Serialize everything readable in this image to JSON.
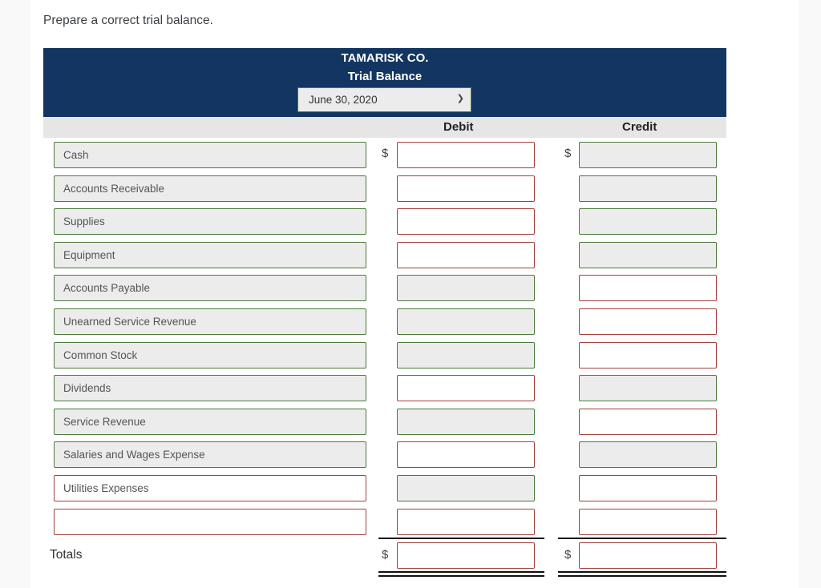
{
  "prompt": "Prepare a correct trial balance.",
  "header": {
    "company": "TAMARISK CO.",
    "title": "Trial Balance",
    "date_select": {
      "selected": "June 30, 2020"
    }
  },
  "columns": {
    "debit": "Debit",
    "credit": "Credit"
  },
  "currency_symbol": "$",
  "rows": [
    {
      "account": "Cash",
      "account_state": "correct",
      "debit": "",
      "debit_state": "incorrect",
      "credit": "",
      "credit_state": "correct"
    },
    {
      "account": "Accounts Receivable",
      "account_state": "correct",
      "debit": "",
      "debit_state": "incorrect",
      "credit": "",
      "credit_state": "correct"
    },
    {
      "account": "Supplies",
      "account_state": "correct",
      "debit": "",
      "debit_state": "incorrect",
      "credit": "",
      "credit_state": "correct"
    },
    {
      "account": "Equipment",
      "account_state": "correct",
      "debit": "",
      "debit_state": "incorrect",
      "credit": "",
      "credit_state": "correct"
    },
    {
      "account": "Accounts Payable",
      "account_state": "correct",
      "debit": "",
      "debit_state": "correct",
      "credit": "",
      "credit_state": "incorrect"
    },
    {
      "account": "Unearned Service Revenue",
      "account_state": "correct",
      "debit": "",
      "debit_state": "correct",
      "credit": "",
      "credit_state": "incorrect"
    },
    {
      "account": "Common Stock",
      "account_state": "correct",
      "debit": "",
      "debit_state": "correct",
      "credit": "",
      "credit_state": "incorrect"
    },
    {
      "account": "Dividends",
      "account_state": "correct",
      "debit": "",
      "debit_state": "incorrect",
      "credit": "",
      "credit_state": "correct"
    },
    {
      "account": "Service Revenue",
      "account_state": "correct",
      "debit": "",
      "debit_state": "correct",
      "credit": "",
      "credit_state": "incorrect"
    },
    {
      "account": "Salaries and Wages Expense",
      "account_state": "correct",
      "debit": "",
      "debit_state": "incorrect",
      "credit": "",
      "credit_state": "correct"
    },
    {
      "account": "Utilities Expenses",
      "account_state": "incorrect",
      "debit": "",
      "debit_state": "correct",
      "credit": "",
      "credit_state": "incorrect"
    },
    {
      "account": "",
      "account_state": "incorrect",
      "debit": "",
      "debit_state": "incorrect",
      "credit": "",
      "credit_state": "incorrect"
    }
  ],
  "totals": {
    "label": "Totals",
    "debit": "",
    "credit": ""
  }
}
